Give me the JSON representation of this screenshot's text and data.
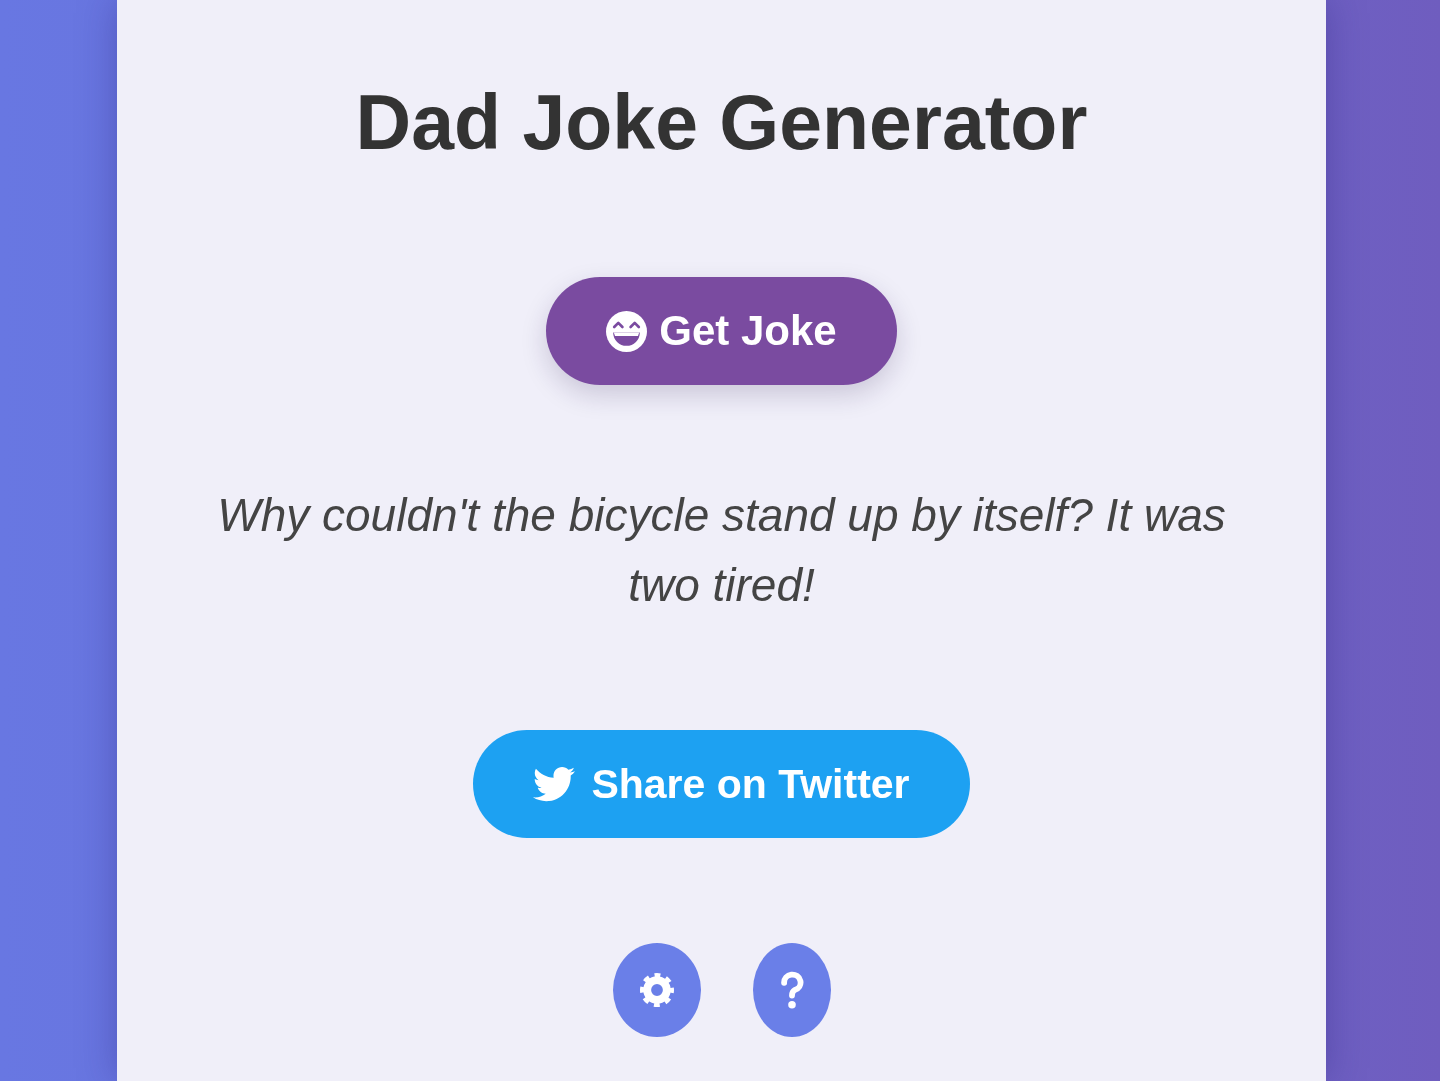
{
  "title": "Dad Joke Generator",
  "get_joke_button": {
    "label": "Get Joke"
  },
  "joke": {
    "text": "Why couldn't the bicycle stand up by itself? It was two tired!"
  },
  "share_button": {
    "label": "Share on Twitter"
  },
  "icon_buttons": [
    {
      "kind": "settings"
    },
    {
      "kind": "help"
    }
  ]
}
